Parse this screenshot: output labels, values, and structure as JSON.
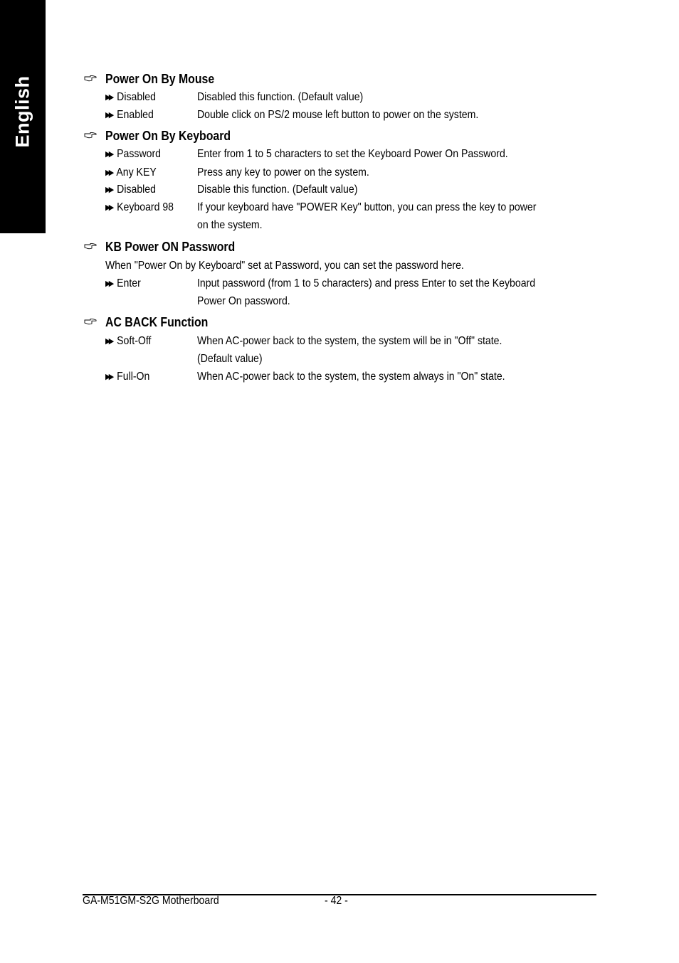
{
  "side_tab": {
    "label": "English"
  },
  "sections": [
    {
      "title": "Power On By Mouse",
      "options": [
        {
          "name": "Disabled",
          "lines": [
            "Disabled this function. (Default value)"
          ]
        },
        {
          "name": "Enabled",
          "lines": [
            "Double click on PS/2 mouse left button to power on the system."
          ]
        }
      ]
    },
    {
      "title": "Power On By Keyboard",
      "options": [
        {
          "name": "Password",
          "lines": [
            "Enter from 1 to 5 characters to set the Keyboard Power On Password."
          ]
        },
        {
          "name": "Any KEY",
          "lines": [
            "Press any key to power on the system."
          ]
        },
        {
          "name": "Disabled",
          "lines": [
            "Disable this function. (Default value)"
          ]
        },
        {
          "name": "Keyboard 98",
          "lines": [
            "If your keyboard have \"POWER Key\" button, you can press the key to power",
            "on the system."
          ]
        }
      ]
    },
    {
      "title": "KB Power ON Password",
      "intro": "When \"Power On by Keyboard\" set at Password, you can set the password here.",
      "options": [
        {
          "name": "Enter",
          "lines": [
            "Input password (from 1 to 5 characters) and press Enter to set the Keyboard",
            "Power On password."
          ]
        }
      ]
    },
    {
      "title": "AC BACK Function",
      "options": [
        {
          "name": "Soft-Off",
          "lines": [
            "When AC-power back to the system, the system will be in \"Off\" state.",
            "(Default value)"
          ]
        },
        {
          "name": "Full-On",
          "lines": [
            "When AC-power back to the system, the system always in \"On\" state."
          ]
        }
      ]
    }
  ],
  "footer": {
    "model": "GA-M51GM-S2G Motherboard",
    "page": "- 42 -"
  }
}
